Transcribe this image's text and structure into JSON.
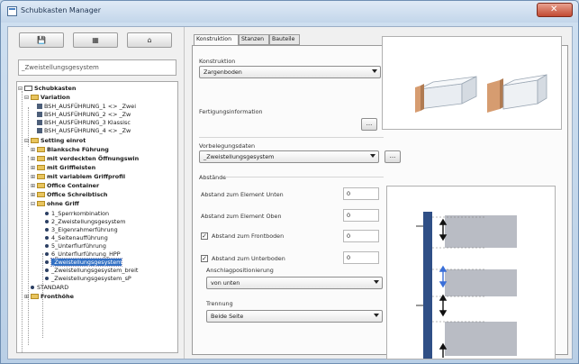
{
  "window": {
    "title": "Schubkasten Manager",
    "close_symbol": "✕"
  },
  "toolbar": {
    "buttons": [
      "💾",
      "▦",
      "⌂"
    ],
    "icons": [
      "save-icon",
      "grid-icon",
      "home-icon"
    ]
  },
  "search": {
    "value": "_Zweistellungsgesystem"
  },
  "tree": {
    "root": "Schubkasten",
    "groups": [
      {
        "label": "Variation",
        "items": [
          "BSH_AUSFÜHRUNG_1 <> _Zwei",
          "BSH_AUSFÜHRUNG_2 <> _Zw",
          "BSH_AUSFÜHRUNG_3 Klassisc",
          "BSH_AUSFÜHRUNG_4 <> _Zw"
        ]
      },
      {
        "label": "Setting einrot"
      }
    ],
    "folders": [
      "Blanksche Führung",
      "mit verdeckten Öffnungswin",
      "mit Griffleisten",
      "mit variablem Griffprofil",
      "Office Container",
      "Office Schreibtisch",
      "ohne Griff"
    ],
    "leaves": [
      "1_Sperrkombination",
      "2_Zweistellungsgesystem",
      "3_Eigenrahmerführung",
      "4_Seitenaufführung",
      "5_Unterflurführung",
      "6_Unterflurführung_HPP",
      "_Zweistellungsgesystem",
      "_Zweistellungsgesystem_breit",
      "_Zweistellungsgesystem_sP"
    ],
    "extra_items": [
      "STANDARD",
      "Fronthöhe"
    ]
  },
  "tabs": [
    "Konstruktion",
    "Stanzen",
    "Bauteile"
  ],
  "form": {
    "konstruktion_label": "Konstruktion",
    "konstruktion_value": "Zargenboden",
    "fertigung_label": "Fertigungsinformation",
    "dots": "...",
    "vorbelegung_label": "Vorbelegungsdaten",
    "vorbelegung_value": "_Zweistellungsgesystem",
    "abstande_label": "Abstände",
    "rows": [
      {
        "label": "Abstand zum Element Unten",
        "value": "0",
        "checked": false,
        "has_check": false
      },
      {
        "label": "Abstand zum Element Oben",
        "value": "0",
        "checked": false,
        "has_check": false
      },
      {
        "label": "Abstand zum Frontboden",
        "value": "0",
        "checked": true,
        "has_check": true
      },
      {
        "label": "Abstand zum Unterboden",
        "value": "0",
        "checked": true,
        "has_check": true
      }
    ],
    "anschlag_label": "Anschlagpositionierung",
    "anschlag_value": "von unten",
    "trennung_label": "Trennung",
    "trennung_value": "Beide Seite"
  },
  "colors": {
    "accent": "#3270c4",
    "panel_blue": "#2f4f86",
    "wood": "#d69c70"
  }
}
